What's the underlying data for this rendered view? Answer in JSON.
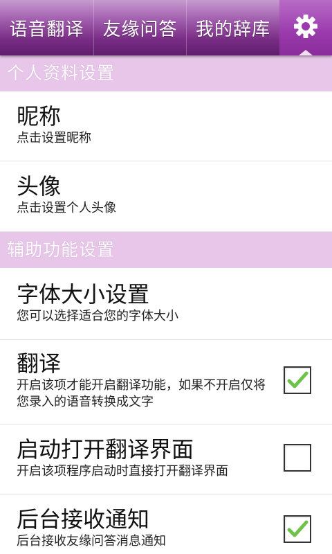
{
  "tabs": {
    "voice_translate": "语音翻译",
    "friend_qa": "友缘问答",
    "my_dictionary": "我的辞库",
    "settings_icon": "gear-icon"
  },
  "sections": {
    "profile": {
      "title": "个人资料设置",
      "items": [
        {
          "title": "昵称",
          "subtitle": "点击设置昵称"
        },
        {
          "title": "头像",
          "subtitle": "点击设置个人头像"
        }
      ]
    },
    "assist": {
      "title": "辅助功能设置",
      "items": [
        {
          "title": "字体大小设置",
          "subtitle": "您可以选择适合您的字体大小"
        },
        {
          "title": "翻译",
          "subtitle": "开启该项才能开启翻译功能，如果不开启仅将您录入的语音转换成文字",
          "checked": true
        },
        {
          "title": "启动打开翻译界面",
          "subtitle": "开启该项程序启动时直接打开翻译界面",
          "checked": false
        },
        {
          "title": "后台接收通知",
          "subtitle": "后台接收友缘问答消息通知",
          "checked": true
        }
      ]
    }
  },
  "colors": {
    "tabbar_accent": "#7a2e86",
    "section_header_bg": "#e7c6e9",
    "check_green": "#6cc24a"
  }
}
